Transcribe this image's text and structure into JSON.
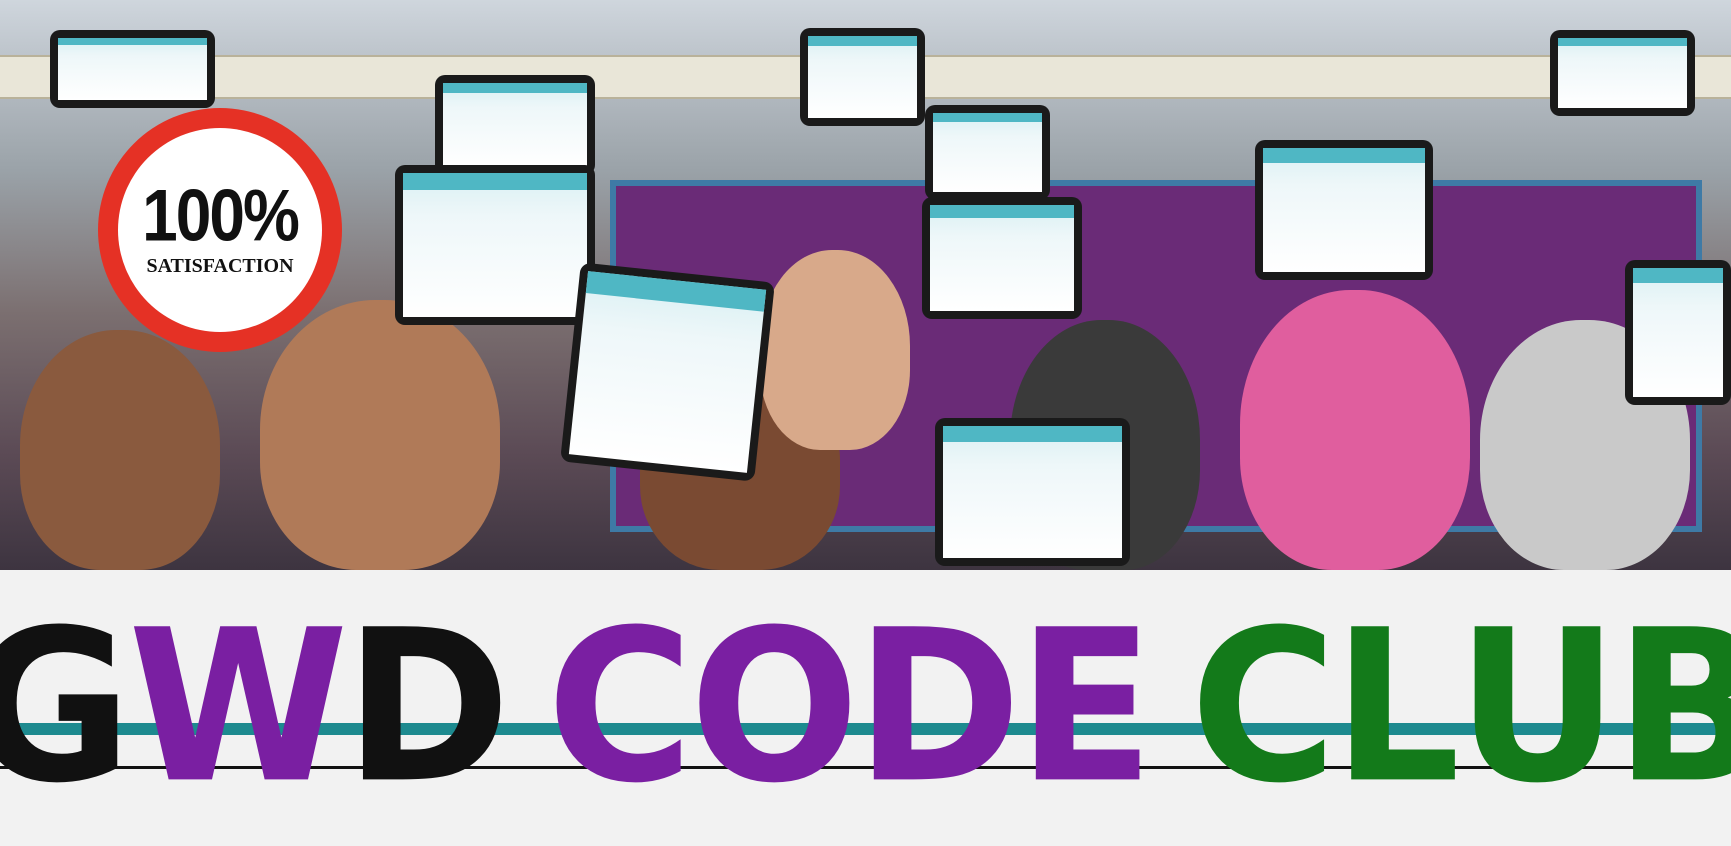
{
  "badge": {
    "percent": "100%",
    "label": "SATISFACTION",
    "ring_color": "#e53125"
  },
  "title": {
    "words": [
      {
        "letters": [
          {
            "char": "G",
            "color": "#111111"
          },
          {
            "char": "W",
            "color": "#7a1fa2"
          },
          {
            "char": "D",
            "color": "#111111"
          }
        ]
      },
      {
        "letters": [
          {
            "char": "C",
            "color": "#7a1fa2"
          },
          {
            "char": "O",
            "color": "#7a1fa2"
          },
          {
            "char": "D",
            "color": "#7a1fa2"
          },
          {
            "char": "E",
            "color": "#7a1fa2"
          }
        ]
      },
      {
        "letters": [
          {
            "char": "C",
            "color": "#137a1a"
          },
          {
            "char": "L",
            "color": "#137a1a"
          },
          {
            "char": "U",
            "color": "#137a1a"
          },
          {
            "char": "B",
            "color": "#137a1a"
          }
        ]
      }
    ]
  },
  "colors": {
    "teal_rule": "#1d8a8f",
    "black_rule": "#111111",
    "banner_bg": "#f2f2f2"
  }
}
